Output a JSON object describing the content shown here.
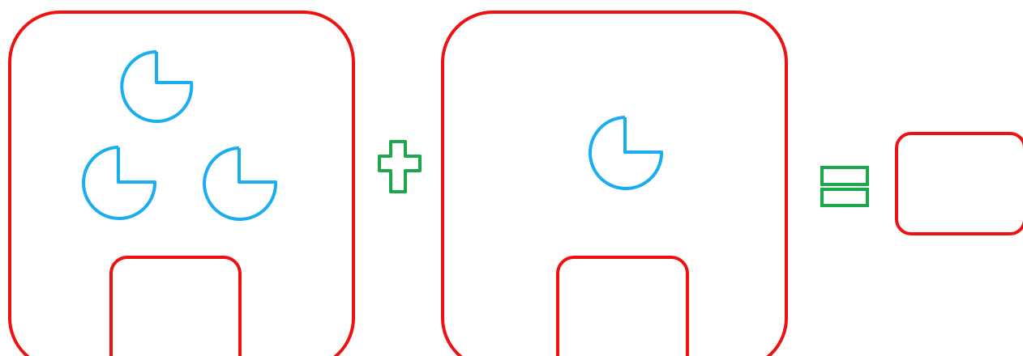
{
  "colors": {
    "box_stroke": "#ee1111",
    "pie_stroke": "#18aef0",
    "operator_stroke": "#1aa84a",
    "background": "#ffffff"
  },
  "equation": {
    "left_group": {
      "pie_icon": "three-quarter-pie-icon",
      "pie_count": 3,
      "answer_box_value": ""
    },
    "plus_operator": "plus-icon",
    "right_group": {
      "pie_icon": "three-quarter-pie-icon",
      "pie_count": 1,
      "answer_box_value": ""
    },
    "equals_operator": "equals-icon",
    "result_box_value": ""
  }
}
